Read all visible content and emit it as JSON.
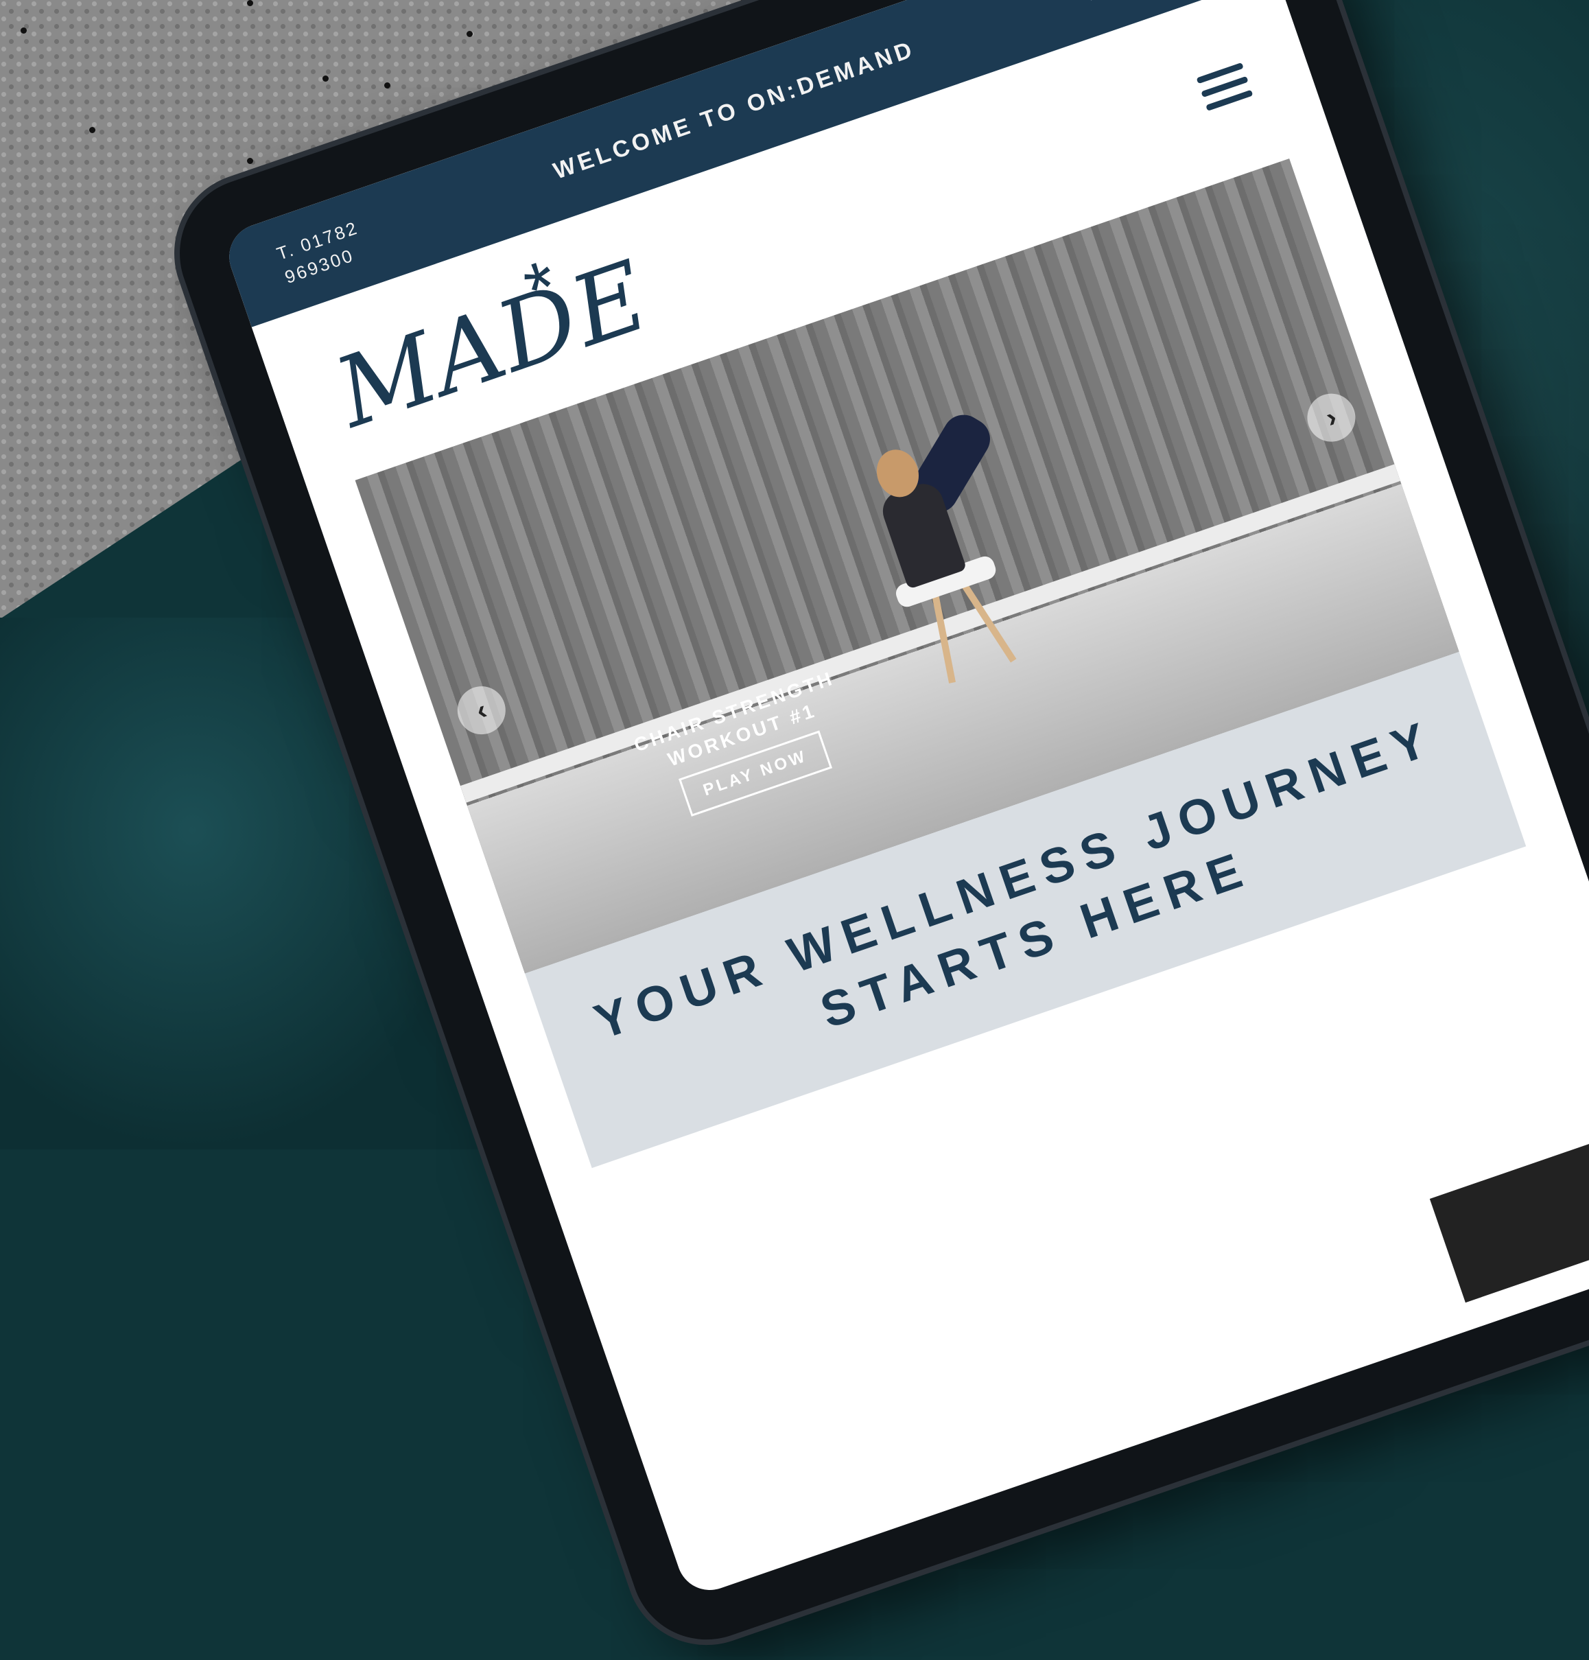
{
  "topbar": {
    "phone_line1": "T. 01782",
    "phone_line2": "969300",
    "welcome": "WELCOME TO ON:DEMAND"
  },
  "social_icons": [
    "facebook-icon",
    "twitter-icon",
    "instagram-icon",
    "email-icon"
  ],
  "logo": {
    "text": "MADE",
    "mark": "*"
  },
  "hero": {
    "caption_line1": "CHAIR STRENGTH",
    "caption_line2": "WORKOUT #1",
    "button_label": "PLAY NOW",
    "prev_icon": "chevron-left-icon",
    "next_icon": "chevron-right-icon"
  },
  "tagline": {
    "line1": "YOUR WELLNESS JOURNEY",
    "line2": "STARTS HERE"
  },
  "colors": {
    "brand_navy": "#1c3a52",
    "tagline_band": "#d9dee3",
    "cushion_teal": "#0f3438"
  }
}
